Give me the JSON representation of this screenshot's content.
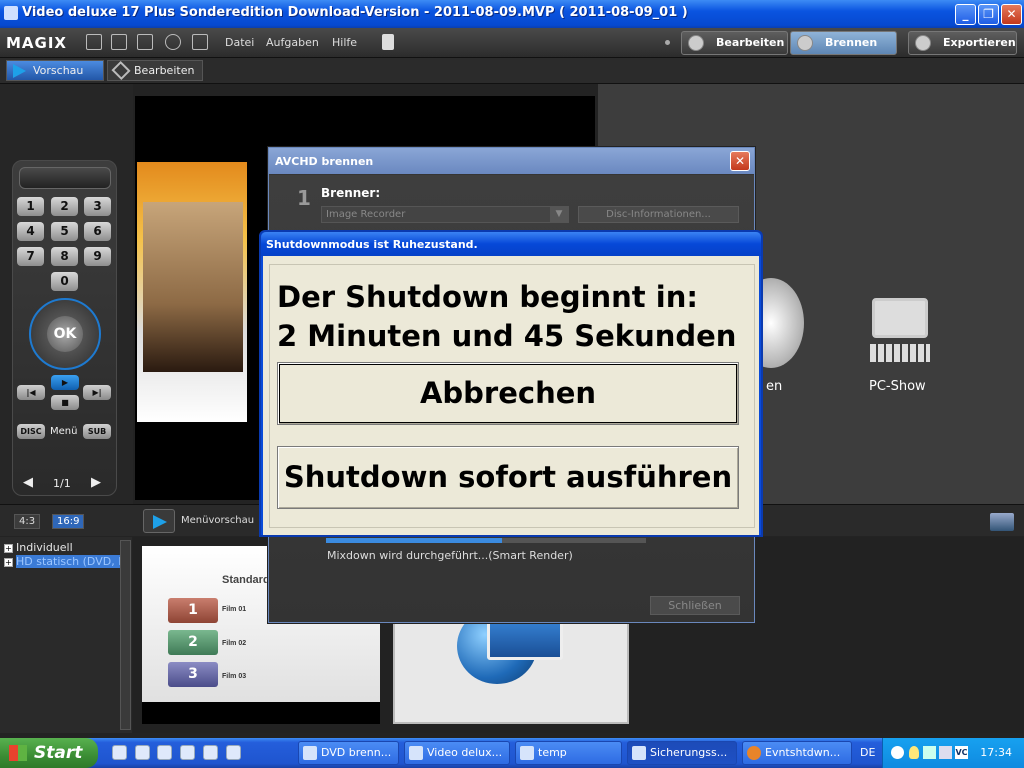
{
  "window": {
    "title": "Video deluxe 17 Plus Sonderedition Download-Version - 2011-08-09.MVP ( 2011-08-09_01 )",
    "btn_min": "_",
    "btn_max": "❐",
    "btn_close": "✕"
  },
  "app": {
    "logo": "MAGIX",
    "menu": [
      "Datei",
      "Aufgaben",
      "Hilfe"
    ],
    "modes": [
      "Bearbeiten",
      "Brennen",
      "Exportieren"
    ]
  },
  "subtabs": [
    "Vorschau",
    "Bearbeiten"
  ],
  "remote": {
    "keys": [
      "1",
      "2",
      "3",
      "4",
      "5",
      "6",
      "7",
      "8",
      "9",
      "0"
    ],
    "ok": "OK",
    "disc": "DISC",
    "menu": "Menü",
    "sub": "SUB",
    "page": "1/1"
  },
  "right_panel": {
    "item_partial": "en",
    "pc_show": "PC-Show"
  },
  "aspect": {
    "options": [
      "4:3",
      "16:9"
    ],
    "selected": "16:9",
    "menu_preview": "Menüvorschau"
  },
  "tree": [
    "Individuell",
    "HD statisch (DVD, B"
  ],
  "templates": {
    "tpl1_title": "Standard",
    "films": [
      "Film 01",
      "Film 02",
      "Film 03"
    ],
    "tiles": [
      "1",
      "2",
      "3"
    ]
  },
  "avchd": {
    "title": "AVCHD brennen",
    "step": "1",
    "brenner_label": "Brenner:",
    "recorder": "Image Recorder",
    "disc_info": "Disc-Informationen...",
    "status": "Mixdown wird durchgeführt...(Smart Render)",
    "close_btn": "Schließen",
    "progress": 0.55
  },
  "shutdown": {
    "title": "Shutdownmodus ist Ruhezustand.",
    "line1": "Der Shutdown beginnt in:",
    "line2": "2 Minuten und 45 Sekunden",
    "cancel": "Abbrechen",
    "now": "Shutdown sofort ausführen"
  },
  "taskbar": {
    "start": "Start",
    "tasks": [
      "DVD brenn...",
      "Video delux...",
      "temp",
      "Sicherungss...",
      "Evntshtdwn..."
    ],
    "lang": "DE",
    "clock": "17:34"
  },
  "colors": {
    "xp_blue": "#0a54e0",
    "start_green": "#3b8d34",
    "dialog_face": "#ece9d8",
    "accent": "#2f67b8"
  }
}
